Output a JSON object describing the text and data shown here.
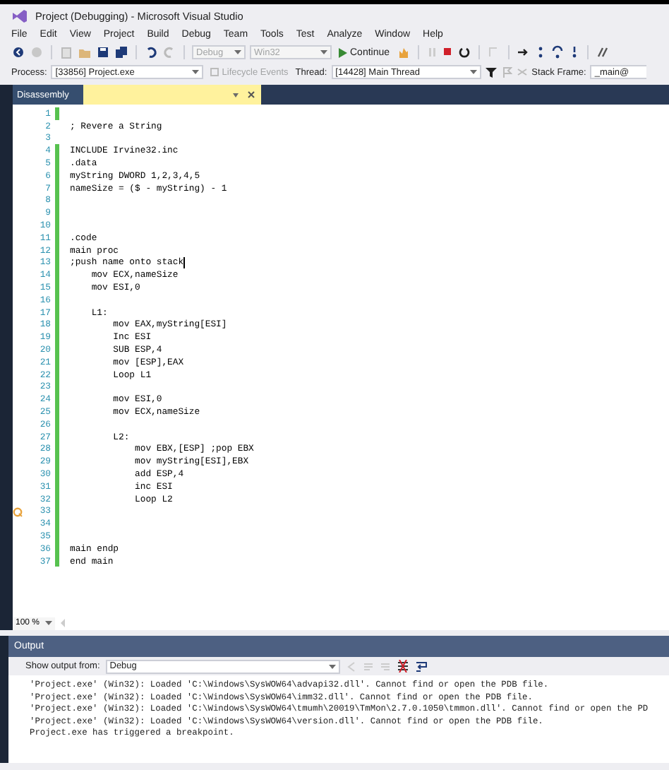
{
  "window": {
    "title": "Project (Debugging) - Microsoft Visual Studio"
  },
  "menu": [
    "File",
    "Edit",
    "View",
    "Project",
    "Build",
    "Debug",
    "Team",
    "Tools",
    "Test",
    "Analyze",
    "Window",
    "Help"
  ],
  "toolbar": {
    "configuration": {
      "value": "Debug",
      "disabled": true
    },
    "platform": {
      "value": "Win32",
      "disabled": true
    },
    "continue_button": "Continue"
  },
  "debug_location": {
    "process_label": "Process:",
    "process": "[33856] Project.exe",
    "lifecycle_events": {
      "label": "Lifecycle Events",
      "disabled": true
    },
    "thread_label": "Thread:",
    "thread": "[14428] Main Thread",
    "stack_frame_label": "Stack Frame:",
    "stack_frame": "_main@"
  },
  "document_tabs": [
    {
      "label": "Disassembly",
      "selected": false
    }
  ],
  "editor": {
    "lines": [
      {
        "number": "1",
        "changed": true,
        "cursor": false,
        "current": false
      },
      {
        "number": "2",
        "text": "; Revere a String",
        "changed": false,
        "cursor": false,
        "current": false
      },
      {
        "number": "3",
        "changed": false,
        "cursor": false,
        "current": false
      },
      {
        "number": "4",
        "text": "INCLUDE Irvine32.inc",
        "changed": true,
        "cursor": false,
        "current": false
      },
      {
        "number": "5",
        "text": ".data",
        "changed": true,
        "cursor": false,
        "current": false
      },
      {
        "number": "6",
        "text": "myString DWORD 1,2,3,4,5",
        "changed": true,
        "cursor": false,
        "current": false
      },
      {
        "number": "7",
        "text": "nameSize = ($ - myString) - 1",
        "changed": true,
        "cursor": false,
        "current": false
      },
      {
        "number": "8",
        "changed": true,
        "cursor": false,
        "current": false
      },
      {
        "number": "9",
        "changed": true,
        "cursor": false,
        "current": false
      },
      {
        "number": "10",
        "changed": true,
        "cursor": false,
        "current": false
      },
      {
        "number": "11",
        "text": ".code",
        "changed": true,
        "cursor": false,
        "current": false
      },
      {
        "number": "12",
        "text": "main proc",
        "changed": true,
        "cursor": false,
        "current": false
      },
      {
        "number": "13",
        "text": ";push name onto stack",
        "changed": true,
        "cursor": true,
        "current": false
      },
      {
        "number": "14",
        "text": "    mov ECX,nameSize",
        "changed": true,
        "cursor": false,
        "current": false
      },
      {
        "number": "15",
        "text": "    mov ESI,0",
        "changed": true,
        "cursor": false,
        "current": false
      },
      {
        "number": "16",
        "changed": true,
        "cursor": false,
        "current": false
      },
      {
        "number": "17",
        "text": "    L1:",
        "changed": true,
        "cursor": false,
        "current": false
      },
      {
        "number": "18",
        "text": "        mov EAX,myString[ESI]",
        "changed": true,
        "cursor": false,
        "current": false
      },
      {
        "number": "19",
        "text": "        Inc ESI",
        "changed": true,
        "cursor": false,
        "current": false
      },
      {
        "number": "20",
        "text": "        SUB ESP,4",
        "changed": true,
        "cursor": false,
        "current": false
      },
      {
        "number": "21",
        "text": "        mov [ESP],EAX",
        "changed": true,
        "cursor": false,
        "current": false
      },
      {
        "number": "22",
        "text": "        Loop L1",
        "changed": true,
        "cursor": false,
        "current": false
      },
      {
        "number": "23",
        "changed": true,
        "cursor": false,
        "current": false
      },
      {
        "number": "24",
        "text": "        mov ESI,0",
        "changed": true,
        "cursor": false,
        "current": false
      },
      {
        "number": "25",
        "text": "        mov ECX,nameSize",
        "changed": true,
        "cursor": false,
        "current": false
      },
      {
        "number": "26",
        "changed": true,
        "cursor": false,
        "current": false
      },
      {
        "number": "27",
        "text": "        L2:",
        "changed": true,
        "cursor": false,
        "current": false
      },
      {
        "number": "28",
        "text": "            mov EBX,[ESP] ;pop EBX",
        "changed": true,
        "cursor": false,
        "current": false
      },
      {
        "number": "29",
        "text": "            mov myString[ESI],EBX",
        "changed": true,
        "cursor": false,
        "current": false
      },
      {
        "number": "30",
        "text": "            add ESP,4",
        "changed": true,
        "cursor": false,
        "current": false
      },
      {
        "number": "31",
        "text": "            inc ESI",
        "changed": true,
        "cursor": false,
        "current": false
      },
      {
        "number": "32",
        "text": "            Loop L2",
        "changed": true,
        "cursor": false,
        "current": false
      },
      {
        "number": "33",
        "changed": true,
        "cursor": false,
        "current": true
      },
      {
        "number": "34",
        "changed": true,
        "cursor": false,
        "current": false
      },
      {
        "number": "35",
        "changed": true,
        "cursor": false,
        "current": false
      },
      {
        "number": "36",
        "text": "main endp",
        "changed": true,
        "cursor": false,
        "current": false
      },
      {
        "number": "37",
        "text": "end main",
        "changed": true,
        "cursor": false,
        "current": false
      }
    ]
  },
  "zoom": "100 %",
  "output": {
    "title": "Output",
    "source_label": "Show output from:",
    "source": "Debug",
    "lines": [
      "'Project.exe' (Win32): Loaded 'C:\\Windows\\SysWOW64\\advapi32.dll'. Cannot find or open the PDB file.",
      "'Project.exe' (Win32): Loaded 'C:\\Windows\\SysWOW64\\imm32.dll'. Cannot find or open the PDB file.",
      "'Project.exe' (Win32): Loaded 'C:\\Windows\\SysWOW64\\tmumh\\20019\\TmMon\\2.7.0.1050\\tmmon.dll'. Cannot find or open the PD",
      "'Project.exe' (Win32): Loaded 'C:\\Windows\\SysWOW64\\version.dll'. Cannot find or open the PDB file.",
      "Project.exe has triggered a breakpoint."
    ]
  }
}
